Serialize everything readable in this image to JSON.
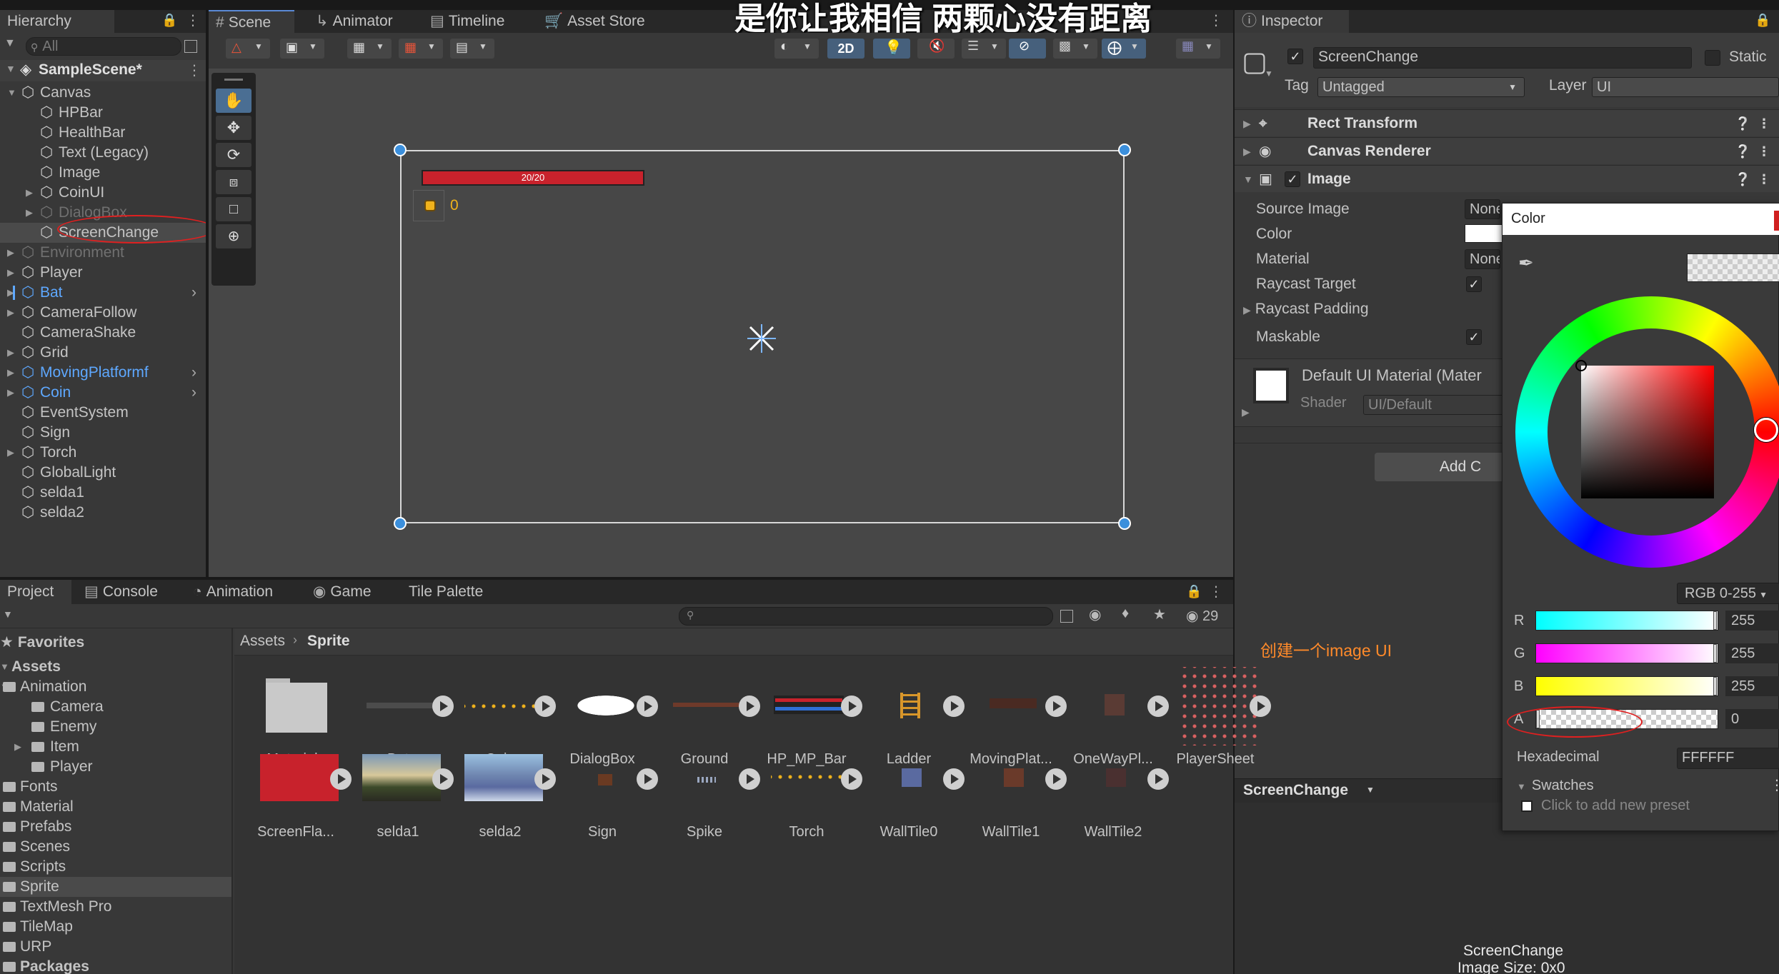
{
  "overlay_subtitle": "是你让我相信   两颗心没有距离",
  "hierarchy": {
    "tab": "Hierarchy",
    "search_placeholder": "All",
    "scene": "SampleScene*",
    "items": [
      {
        "label": "Canvas",
        "indent": 1,
        "fold": "open",
        "style": "normal"
      },
      {
        "label": "HPBar",
        "indent": 2,
        "fold": "",
        "style": "normal"
      },
      {
        "label": "HealthBar",
        "indent": 2,
        "fold": "",
        "style": "normal"
      },
      {
        "label": "Text (Legacy)",
        "indent": 2,
        "fold": "",
        "style": "normal"
      },
      {
        "label": "Image",
        "indent": 2,
        "fold": "",
        "style": "normal"
      },
      {
        "label": "CoinUI",
        "indent": 2,
        "fold": "closed",
        "style": "normal"
      },
      {
        "label": "DialogBox",
        "indent": 2,
        "fold": "closed",
        "style": "disabled"
      },
      {
        "label": "ScreenChange",
        "indent": 2,
        "fold": "",
        "style": "selected"
      },
      {
        "label": "Environment",
        "indent": 1,
        "fold": "closed",
        "style": "disabled"
      },
      {
        "label": "Player",
        "indent": 1,
        "fold": "closed",
        "style": "normal"
      },
      {
        "label": "Bat",
        "indent": 1,
        "fold": "closed",
        "style": "prefab"
      },
      {
        "label": "CameraFollow",
        "indent": 1,
        "fold": "closed",
        "style": "normal"
      },
      {
        "label": "CameraShake",
        "indent": 1,
        "fold": "",
        "style": "normal"
      },
      {
        "label": "Grid",
        "indent": 1,
        "fold": "closed",
        "style": "normal"
      },
      {
        "label": "MovingPlatformf",
        "indent": 1,
        "fold": "closed",
        "style": "prefab"
      },
      {
        "label": "Coin",
        "indent": 1,
        "fold": "closed",
        "style": "prefab"
      },
      {
        "label": "EventSystem",
        "indent": 1,
        "fold": "",
        "style": "normal"
      },
      {
        "label": "Sign",
        "indent": 1,
        "fold": "",
        "style": "normal"
      },
      {
        "label": "Torch",
        "indent": 1,
        "fold": "closed",
        "style": "normal"
      },
      {
        "label": "GlobalLight",
        "indent": 1,
        "fold": "",
        "style": "normal"
      },
      {
        "label": "selda1",
        "indent": 1,
        "fold": "",
        "style": "normal"
      },
      {
        "label": "selda2",
        "indent": 1,
        "fold": "",
        "style": "normal"
      }
    ]
  },
  "scene_tabs": [
    "Scene",
    "Animator",
    "Timeline",
    "Asset Store"
  ],
  "scene_toolbar": {
    "mode_2d": "2D"
  },
  "scene_view": {
    "hp_text": "20/20",
    "coin_count": "0"
  },
  "inspector": {
    "tab": "Inspector",
    "object_name": "ScreenChange",
    "static_label": "Static",
    "tag_label": "Tag",
    "tag_value": "Untagged",
    "layer_label": "Layer",
    "layer_value": "UI",
    "components": [
      "Rect Transform",
      "Canvas Renderer",
      "Image"
    ],
    "image_props": {
      "source_image": "Source Image",
      "source_value": "None",
      "color": "Color",
      "material": "Material",
      "material_value": "None",
      "raycast_target": "Raycast Target",
      "raycast_padding": "Raycast Padding",
      "maskable": "Maskable"
    },
    "material_name": "Default UI Material (Mater",
    "shader_label": "Shader",
    "shader_value": "UI/Default",
    "add_component": "Add C",
    "annotation": "创建一个image UI",
    "footer_name": "ScreenChange",
    "preview_name": "ScreenChange",
    "preview_size": "Image Size: 0x0"
  },
  "color_picker": {
    "title": "Color",
    "mode": "RGB 0-255",
    "channels": [
      {
        "label": "R",
        "value": "255"
      },
      {
        "label": "G",
        "value": "255"
      },
      {
        "label": "B",
        "value": "255"
      },
      {
        "label": "A",
        "value": "0"
      }
    ],
    "hex_label": "Hexadecimal",
    "hex_value": "FFFFFF",
    "swatches_label": "Swatches",
    "swatches_hint": "Click to add new preset"
  },
  "bottom_tabs": [
    "Project",
    "Console",
    "Animation",
    "Game",
    "Tile Palette"
  ],
  "project": {
    "count": "29",
    "favorites": "Favorites",
    "assets_root": "Assets",
    "breadcrumb": [
      "Assets",
      "Sprite"
    ],
    "tree": [
      {
        "label": "Animation",
        "indent": 1,
        "fold": "open"
      },
      {
        "label": "Camera",
        "indent": 2,
        "fold": ""
      },
      {
        "label": "Enemy",
        "indent": 2,
        "fold": ""
      },
      {
        "label": "Item",
        "indent": 2,
        "fold": "closed"
      },
      {
        "label": "Player",
        "indent": 2,
        "fold": ""
      },
      {
        "label": "Fonts",
        "indent": 1,
        "fold": ""
      },
      {
        "label": "Material",
        "indent": 1,
        "fold": ""
      },
      {
        "label": "Prefabs",
        "indent": 1,
        "fold": ""
      },
      {
        "label": "Scenes",
        "indent": 1,
        "fold": ""
      },
      {
        "label": "Scripts",
        "indent": 1,
        "fold": ""
      },
      {
        "label": "Sprite",
        "indent": 1,
        "fold": "",
        "selected": true
      },
      {
        "label": "TextMesh Pro",
        "indent": 1,
        "fold": ""
      },
      {
        "label": "TileMap",
        "indent": 1,
        "fold": ""
      },
      {
        "label": "URP",
        "indent": 1,
        "fold": ""
      },
      {
        "label": "Packages",
        "indent": 0,
        "fold": ""
      }
    ],
    "assets_row1": [
      "Materials",
      "Bat",
      "Coin",
      "DialogBox",
      "Ground",
      "HP_MP_Bar",
      "Ladder",
      "MovingPlat...",
      "OneWayPl...",
      "PlayerSheet"
    ],
    "assets_row2": [
      "ScreenFla...",
      "selda1",
      "selda2",
      "Sign",
      "Spike",
      "Torch",
      "WallTile0",
      "WallTile1",
      "WallTile2"
    ]
  },
  "colors": {
    "accent": "#5b8ad6",
    "selected_row": "#2c5d87",
    "prefab_text": "#5ea8ff",
    "annotation": "#ff8a2a",
    "circle": "#e02020",
    "hp_red": "#c8222c"
  }
}
